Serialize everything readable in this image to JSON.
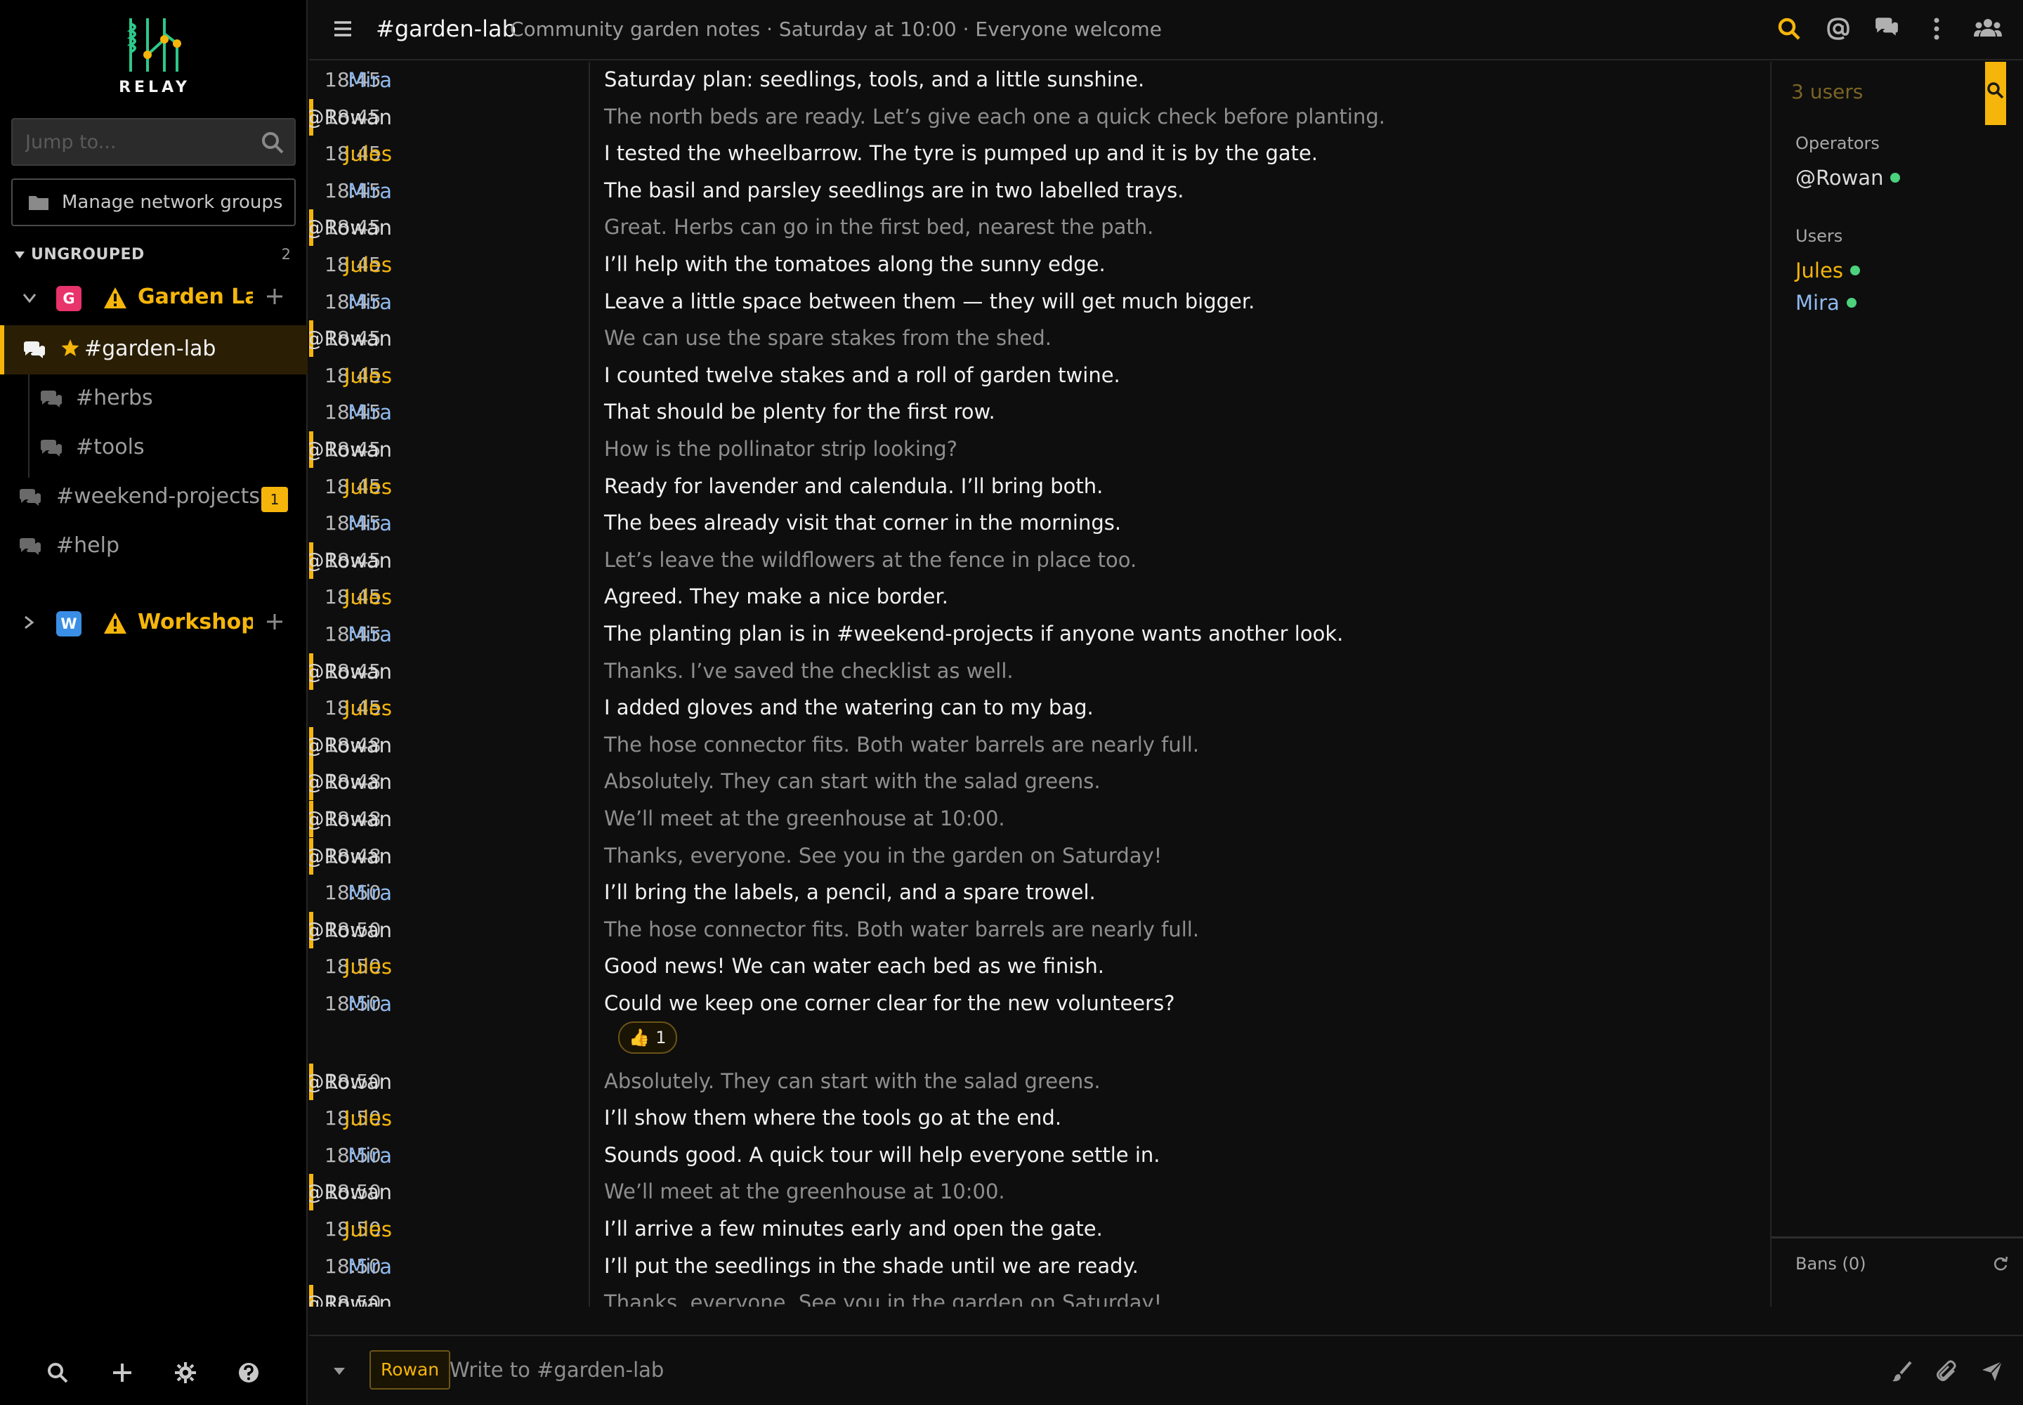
{
  "app": {
    "name": "RELAY"
  },
  "sidebar": {
    "jump_placeholder": "Jump to...",
    "manage_label": "Manage network groups",
    "group_label": "UNGROUPED",
    "group_count": "2",
    "networks": [
      {
        "badge": "G",
        "badge_color": "#e8336b",
        "name": "Garden Lab",
        "expanded": true,
        "channels": [
          "#garden-lab",
          "#herbs",
          "#tools",
          "#weekend-projects",
          "#help"
        ],
        "active_channel": "#garden-lab",
        "unread": {
          "#weekend-projects": "1"
        }
      },
      {
        "badge": "W",
        "badge_color": "#3a8ee6",
        "name": "Workshop",
        "expanded": false
      }
    ],
    "bottom_icons": [
      "search-icon",
      "plus-icon",
      "gear-icon",
      "help-icon"
    ]
  },
  "header": {
    "channel": "#garden-lab",
    "topic": "Community garden notes · Saturday at 10:00 · Everyone welcome",
    "icons": [
      "search-icon",
      "mention-icon",
      "chat-icon",
      "more-icon",
      "users-icon"
    ]
  },
  "colors": {
    "accent": "#f5b50a",
    "nick_mira": "#8fb9ef",
    "nick_jules": "#f5b50a",
    "nick_self": "#dadada",
    "online": "#4cd17d"
  },
  "messages": [
    {
      "time": "18:45",
      "nick": "Mira",
      "text": "Saturday plan: seedlings, tools, and a little sunshine."
    },
    {
      "time": "18:45",
      "nick": "@Rowan",
      "text": "The north beds are ready. Let’s give each one a quick check before planting."
    },
    {
      "time": "18:45",
      "nick": "Jules",
      "text": "I tested the wheelbarrow. The tyre is pumped up and it is by the gate."
    },
    {
      "time": "18:45",
      "nick": "Mira",
      "text": "The basil and parsley seedlings are in two labelled trays."
    },
    {
      "time": "18:45",
      "nick": "@Rowan",
      "text": "Great. Herbs can go in the first bed, nearest the path."
    },
    {
      "time": "18:45",
      "nick": "Jules",
      "text": "I’ll help with the tomatoes along the sunny edge."
    },
    {
      "time": "18:45",
      "nick": "Mira",
      "text": "Leave a little space between them — they will get much bigger."
    },
    {
      "time": "18:45",
      "nick": "@Rowan",
      "text": "We can use the spare stakes from the shed."
    },
    {
      "time": "18:45",
      "nick": "Jules",
      "text": "I counted twelve stakes and a roll of garden twine."
    },
    {
      "time": "18:45",
      "nick": "Mira",
      "text": "That should be plenty for the first row."
    },
    {
      "time": "18:45",
      "nick": "@Rowan",
      "text": "How is the pollinator strip looking?"
    },
    {
      "time": "18:45",
      "nick": "Jules",
      "text": "Ready for lavender and calendula. I’ll bring both."
    },
    {
      "time": "18:45",
      "nick": "Mira",
      "text": "The bees already visit that corner in the mornings."
    },
    {
      "time": "18:45",
      "nick": "@Rowan",
      "text": "Let’s leave the wildflowers at the fence in place too."
    },
    {
      "time": "18:45",
      "nick": "Jules",
      "text": "Agreed. They make a nice border."
    },
    {
      "time": "18:45",
      "nick": "Mira",
      "text": "The planting plan is in #weekend-projects if anyone wants another look."
    },
    {
      "time": "18:45",
      "nick": "@Rowan",
      "text": "Thanks. I’ve saved the checklist as well."
    },
    {
      "time": "18:45",
      "nick": "Jules",
      "text": "I added gloves and the watering can to my bag."
    },
    {
      "time": "18:48",
      "nick": "@Rowan",
      "text": "The hose connector fits. Both water barrels are nearly full."
    },
    {
      "time": "18:48",
      "nick": "@Rowan",
      "text": "Absolutely. They can start with the salad greens."
    },
    {
      "time": "18:48",
      "nick": "@Rowan",
      "text": "We’ll meet at the greenhouse at 10:00."
    },
    {
      "time": "18:48",
      "nick": "@Rowan",
      "text": "Thanks, everyone. See you in the garden on Saturday!"
    },
    {
      "time": "18:50",
      "nick": "Mira",
      "text": "I’ll bring the labels, a pencil, and a spare trowel."
    },
    {
      "time": "18:50",
      "nick": "@Rowan",
      "text": "The hose connector fits. Both water barrels are nearly full."
    },
    {
      "time": "18:50",
      "nick": "Jules",
      "text": "Good news! We can water each bed as we finish."
    },
    {
      "time": "18:50",
      "nick": "Mira",
      "text": "Could we keep one corner clear for the new volunteers?"
    },
    {
      "time": "18:50",
      "nick": "@Rowan",
      "text": "Absolutely. They can start with the salad greens."
    },
    {
      "time": "18:50",
      "nick": "Jules",
      "text": "I’ll show them where the tools go at the end."
    },
    {
      "time": "18:50",
      "nick": "Mira",
      "text": "Sounds good. A quick tour will help everyone settle in."
    },
    {
      "time": "18:50",
      "nick": "@Rowan",
      "text": "We’ll meet at the greenhouse at 10:00."
    },
    {
      "time": "18:50",
      "nick": "Jules",
      "text": "I’ll arrive a few minutes early and open the gate."
    },
    {
      "time": "18:50",
      "nick": "Mira",
      "text": "I’ll put the seedlings in the shade until we are ready."
    },
    {
      "time": "18:50",
      "nick": "@Rowan",
      "text": "Thanks, everyone. See you in the garden on Saturday!"
    }
  ],
  "reaction": {
    "emoji": "👍",
    "count": "1"
  },
  "userlist": {
    "count": "3 users",
    "operators_label": "Operators",
    "operators": [
      "@Rowan"
    ],
    "users_label": "Users",
    "users": [
      "Jules",
      "Mira"
    ],
    "bans_label": "Bans (0)"
  },
  "composer": {
    "nick": "Rowan",
    "placeholder": "Write to #garden-lab",
    "icons": [
      "format-icon",
      "attach-icon",
      "send-icon"
    ]
  }
}
